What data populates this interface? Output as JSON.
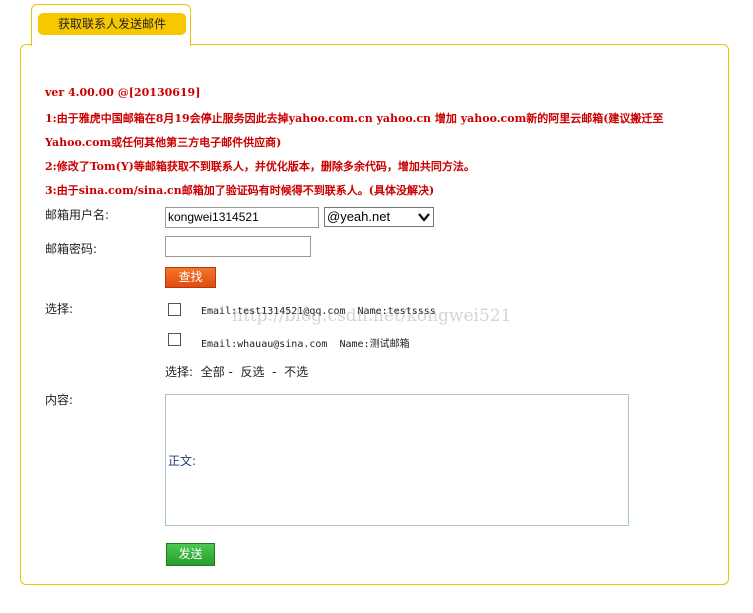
{
  "tab": {
    "title": "获取联系人发送邮件"
  },
  "notices": [
    "ver 4.00.00 @[20130619]",
    "1:由于雅虎中国邮箱在8月19会停止服务因此去掉yahoo.com.cn yahoo.cn 增加 yahoo.com新的阿里云邮箱(建议搬迁至",
    "Yahoo.com或任何其他第三方电子邮件供应商)",
    "2:修改了Tom(Y)等邮箱获取不到联系人，并优化版本，删除多余代码，增加共同方法。",
    "3:由于sina.com/sina.cn邮箱加了验证码有时候得不到联系人。(具体没解决)"
  ],
  "form": {
    "username_label": "邮箱用户名:",
    "username_value": "kongwei1314521",
    "domain_selected": "@yeah.net",
    "password_label": "邮箱密码:",
    "password_value": "",
    "find_button": "查找",
    "select_label": "选择:",
    "contacts": [
      {
        "text": "Email:test1314521@qq.com  Name:testssss"
      },
      {
        "text": "Email:whauau@sina.com  Name:测试邮箱"
      }
    ],
    "select_actions": {
      "prefix": "选择:",
      "all": "全部",
      "invert": "反选",
      "none": "不选",
      "separator": "-"
    },
    "content_label": "内容:",
    "body_text": "正文:",
    "send_button": "发送"
  },
  "watermark": "http://blog.csdn.net/kongwei521",
  "colors": {
    "accent_border": "#e5c600",
    "tab_fill": "#f7c700",
    "notice_text": "#cc0000",
    "find_button": "#e8531a",
    "send_button": "#2faa33"
  },
  "icons": {
    "select_arrow": "chevron-down-icon"
  }
}
